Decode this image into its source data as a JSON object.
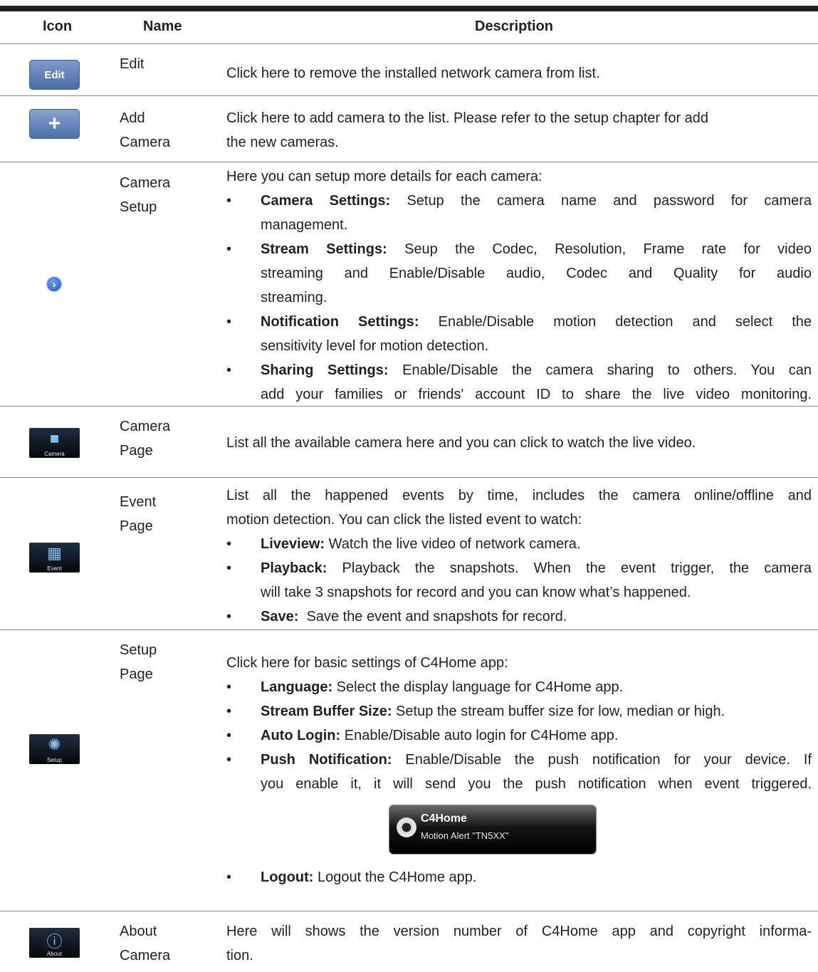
{
  "header": {
    "icon": "Icon",
    "name": "Name",
    "description": "Description"
  },
  "rows": [
    {
      "icon_label": "Edit",
      "icon_name": "edit-button-icon",
      "name": [
        "Edit"
      ],
      "description": "Click here to remove the installed network camera from list."
    },
    {
      "icon_label": "+",
      "icon_name": "add-button-icon",
      "name": [
        "Add",
        "Camera"
      ],
      "description_lines": [
        "Click here to add camera to the list. Please refer to the setup chapter for add",
        "the new cameras."
      ]
    },
    {
      "icon_label": "›",
      "icon_name": "detail-arrow-icon",
      "name": [
        "Camera",
        "Setup"
      ],
      "intro": "Here you can setup more details for each camera:",
      "bullets": [
        {
          "bold": "Camera Settings:",
          "text_lines": [
            " Setup the camera name and password for camera",
            "management."
          ]
        },
        {
          "bold": "Stream Settings:",
          "text_lines": [
            " Seup the Codec, Resolution, Frame rate for video",
            "streaming and Enable/Disable audio, Codec and Quality for audio",
            "streaming."
          ]
        },
        {
          "bold": "Notification Settings:",
          "text_lines": [
            " Enable/Disable motion detection and select the",
            "sensitivity level for motion detection."
          ]
        },
        {
          "bold": "Sharing Settings:",
          "text_lines": [
            " Enable/Disable the camera sharing to others. You can",
            "add your families or friends' account ID to share the live video monitoring."
          ]
        }
      ]
    },
    {
      "icon_label": "Camera",
      "icon_name": "camera-tab-icon",
      "name": [
        "Camera",
        "Page"
      ],
      "description": "List all the available camera here and you can click to watch the live video."
    },
    {
      "icon_label": "Event",
      "icon_name": "event-tab-icon",
      "name": [
        "Event",
        "Page"
      ],
      "intro_lines": [
        "List all the happened events by time, includes the camera online/offline and",
        "motion detection. You can click the listed event to watch:"
      ],
      "bullets": [
        {
          "bold": "Liveview:",
          "text_lines": [
            " Watch the live video of network camera."
          ]
        },
        {
          "bold": "Playback:",
          "text_lines": [
            " Playback the snapshots. When the event trigger, the camera",
            "will take 3 snapshots for record and you can know what’s happened."
          ]
        },
        {
          "bold": "Save:",
          "text_lines": [
            "  Save the event and snapshots for record."
          ]
        }
      ]
    },
    {
      "icon_label": "Setup",
      "icon_name": "setup-tab-icon",
      "name": [
        "Setup",
        "Page"
      ],
      "intro": "Click here for basic settings of C4Home app:",
      "bullets": [
        {
          "bold": "Language:",
          "text_lines": [
            " Select the display language for C4Home app."
          ]
        },
        {
          "bold": "Stream Buffer Size:",
          "text_lines": [
            " Setup the stream buffer size for low, median or high."
          ]
        },
        {
          "bold": "Auto Login:",
          "text_lines": [
            " Enable/Disable auto login for C4Home app."
          ]
        },
        {
          "bold": "Push Notification:",
          "text_lines": [
            " Enable/Disable the push notification for your device. If",
            "you enable it, it will send you the push notification when event triggered."
          ]
        },
        {
          "bold": "Logout:",
          "text_lines": [
            " Logout the C4Home app."
          ]
        }
      ],
      "notification": {
        "app": "C4Home",
        "message": "Motion Alert \"TN5XX\""
      }
    },
    {
      "icon_label": "About",
      "icon_name": "about-tab-icon",
      "name": [
        "About",
        "Camera"
      ],
      "description_lines": [
        "Here will shows the version number of C4Home app and copyright informa-",
        "tion."
      ]
    }
  ]
}
